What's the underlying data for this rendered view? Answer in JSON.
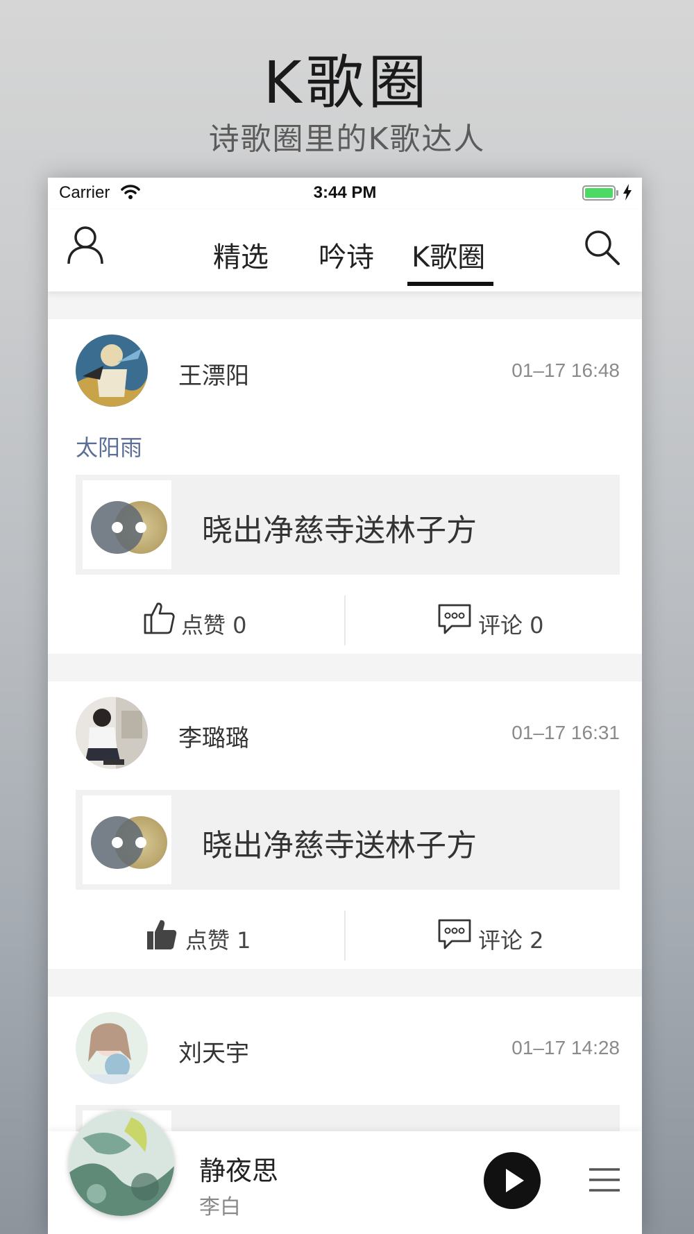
{
  "hero": {
    "title": "K歌圈",
    "subtitle": "诗歌圈里的K歌达人"
  },
  "status_bar": {
    "carrier": "Carrier",
    "time": "3:44 PM",
    "wifi_icon": "wifi-icon",
    "battery_icon": "battery-full-icon",
    "battery_color": "#4cd964"
  },
  "nav": {
    "profile_icon": "user-profile-icon",
    "search_icon": "search-icon",
    "tabs": [
      {
        "label": "精选",
        "active": false
      },
      {
        "label": "吟诗",
        "active": false
      },
      {
        "label": "K歌圈",
        "active": true
      }
    ]
  },
  "feed": [
    {
      "username": "王漂阳",
      "time": "01–17 16:48",
      "text": "太阳雨",
      "song_title": "晓出净慈寺送林子方",
      "like_label": "点赞 0",
      "comment_label": "评论 0",
      "liked": false
    },
    {
      "username": "李璐璐",
      "time": "01–17 16:31",
      "text": "",
      "song_title": "晓出净慈寺送林子方",
      "like_label": "点赞 1",
      "comment_label": "评论 2",
      "liked": true
    },
    {
      "username": "刘天宇",
      "time": "01–17 14:28"
    }
  ],
  "player": {
    "title": "静夜思",
    "artist": "李白",
    "play_icon": "play-icon",
    "menu_icon": "menu-icon"
  },
  "colors": {
    "accent": "#111111",
    "tag_text": "#5b6e96",
    "song_box_bg": "#f1f1f1"
  }
}
